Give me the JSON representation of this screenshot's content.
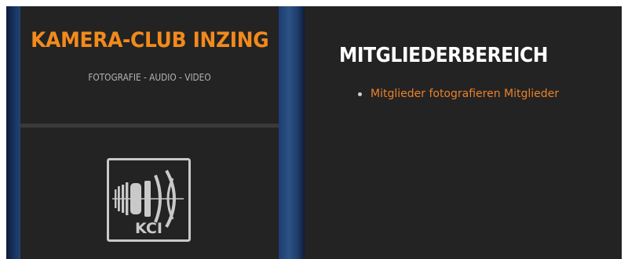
{
  "sidebar": {
    "site_title": "KAMERA-CLUB INZING",
    "tagline": "FOTOGRAFIE - AUDIO - VIDEO",
    "logo_text": "KCI"
  },
  "main": {
    "heading": "MITGLIEDERBEREICH",
    "links": [
      {
        "label": "Mitglieder fotografieren Mitglieder"
      }
    ]
  },
  "colors": {
    "accent": "#f28a1c",
    "panel_bg": "#232323",
    "side_strip": "#254a7f",
    "heading": "#ffffff"
  },
  "icons": {
    "logo": "camera-lens-icon"
  }
}
